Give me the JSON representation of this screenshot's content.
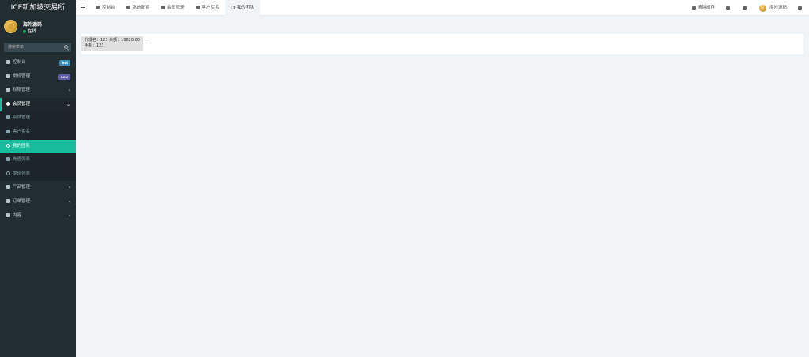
{
  "app": {
    "title": "ICE新加坡交易所"
  },
  "user": {
    "name": "海外源码",
    "status": "在线"
  },
  "search": {
    "placeholder": "搜索菜单"
  },
  "colors": {
    "accent": "#18bc9c",
    "sidebar_bg": "#222d32",
    "badge_blue": "#3c8dbc",
    "badge_purple": "#605ca8",
    "online": "#00a65a"
  },
  "menu": [
    {
      "label": "控制台",
      "icon": "dashboard-icon",
      "badge": "hot",
      "badge_color": "#3c8dbc"
    },
    {
      "label": "常规管理",
      "icon": "cogs-icon",
      "badge": "new",
      "badge_color": "#605ca8"
    },
    {
      "label": "权限管理",
      "icon": "group-icon",
      "chev": "‹"
    },
    {
      "label": "会员管理",
      "icon": "user-circle-icon",
      "chev": "⌄",
      "open": true
    },
    {
      "label": "产品管理",
      "icon": "product-icon",
      "chev": "‹"
    },
    {
      "label": "订单管理",
      "icon": "order-icon",
      "chev": "‹"
    },
    {
      "label": "内容",
      "icon": "content-icon",
      "chev": "‹"
    }
  ],
  "submenu": [
    {
      "label": "会员管理",
      "icon": "user-icon"
    },
    {
      "label": "客户实名",
      "icon": "user-icon"
    },
    {
      "label": "我的团队",
      "icon": "circle-icon",
      "active": true
    },
    {
      "label": "充值列表",
      "icon": "yen-icon"
    },
    {
      "label": "提现列表",
      "icon": "circle-icon"
    }
  ],
  "tabs": [
    {
      "label": "控制台",
      "icon": "dashboard-icon"
    },
    {
      "label": "系统配置",
      "icon": "gear-icon"
    },
    {
      "label": "会员管理",
      "icon": "user-icon"
    },
    {
      "label": "客户实名",
      "icon": "user-icon"
    },
    {
      "label": "我的团队",
      "icon": "circle-icon",
      "active": true
    }
  ],
  "topright": {
    "clear_cache": "清除缓存",
    "user_name": "海外源码"
  },
  "content": {
    "line1": "代理名：123 余额：19820.00",
    "line2": "手机：123",
    "dash": "–"
  }
}
